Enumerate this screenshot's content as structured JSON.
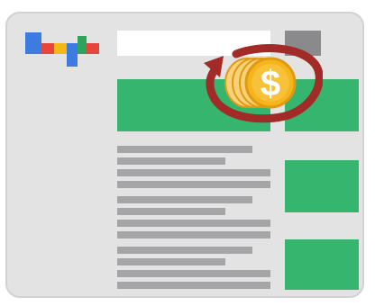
{
  "icons": {
    "logo": "colored-bar-logo-icon",
    "coin": "dollar-coin-stack-icon",
    "refresh_arrow": "circular-arrow-icon"
  },
  "colors": {
    "frame": "#e3e3e4",
    "ad_block": "#35b56e",
    "text_line": "#a5a5a7",
    "search_button": "#8a8a8c",
    "coin": "#f6b51c",
    "arrow": "#a22a27",
    "logo": [
      "#3c7ce0",
      "#e5453a",
      "#f3b816",
      "#2ea35a"
    ]
  },
  "coin": {
    "symbol": "$"
  }
}
